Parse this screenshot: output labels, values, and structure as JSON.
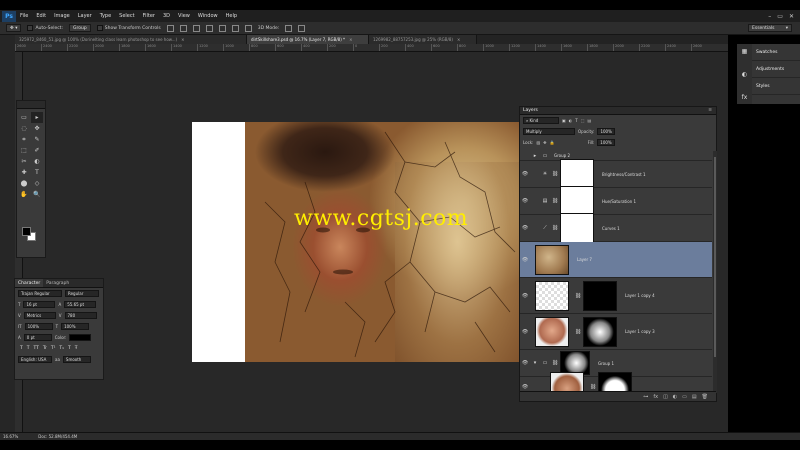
{
  "app": {
    "logo": "Ps"
  },
  "menu": [
    "File",
    "Edit",
    "Image",
    "Layer",
    "Type",
    "Select",
    "Filter",
    "3D",
    "View",
    "Window",
    "Help"
  ],
  "window_controls": [
    "–",
    "▭",
    "✕"
  ],
  "options": {
    "auto_select": "Auto-Select:",
    "group": "Group",
    "show_transform": "Show Transform Controls",
    "mode_3d": "3D Mode:",
    "workspace": "Essentials"
  },
  "tabs": [
    {
      "label": "325972_8460_51.jpg @ 100% (Dorinelting class learn photoshop to see how...)"
    },
    {
      "label": "dirtSkillshare3.psd @ 16.7% (Layer 7, RGB/8) *"
    },
    {
      "label": "1269982_88757253.jpg @ 25% (RGB/8)"
    }
  ],
  "ruler_ticks": [
    "2600",
    "2400",
    "2200",
    "2000",
    "1800",
    "1600",
    "1400",
    "1200",
    "1000",
    "800",
    "600",
    "400",
    "200",
    "0",
    "200",
    "400",
    "600",
    "800",
    "1000",
    "1200",
    "1400",
    "1600",
    "1800",
    "2000",
    "2200",
    "2400",
    "2600"
  ],
  "watermark": "www.cgtsj.com",
  "tools": [
    "▭",
    "▸",
    "◌",
    "✥",
    "⌗",
    "✎",
    "⬚",
    "✐",
    "✂",
    "◐",
    "✚",
    "T",
    "⬤",
    "◇",
    "✋",
    "🔍"
  ],
  "character": {
    "tabs": [
      "Character",
      "Paragraph"
    ],
    "font": "Trajan Regular",
    "style": "Regular",
    "size": "16 pt",
    "leading": "55.65 pt",
    "kerning": "Metrics",
    "tracking": "780",
    "scale_v": "100%",
    "scale_h": "100%",
    "baseline": "0 pt",
    "color_label": "Color:",
    "styles": [
      "T",
      "T",
      "TT",
      "Tr",
      "T¹",
      "T₁",
      "T",
      "Ŧ"
    ],
    "language": "English: USA",
    "aa_label": "aa",
    "antialias": "Smooth"
  },
  "layers_panel": {
    "title": "Layers",
    "kind": "Kind",
    "blend": "Multiply",
    "opacity_label": "Opacity:",
    "opacity": "100%",
    "lock_label": "Lock:",
    "fill_label": "Fill:",
    "fill": "100%",
    "layers": [
      {
        "name": "Group 2",
        "type": "group"
      },
      {
        "name": "Brightness/Contrast 1",
        "type": "adjust",
        "icon": "☀"
      },
      {
        "name": "Hue/Saturation 1",
        "type": "adjust",
        "icon": "▤"
      },
      {
        "name": "Curves 1",
        "type": "adjust",
        "icon": "⟋"
      },
      {
        "name": "Layer 7",
        "type": "pixel",
        "active": true
      },
      {
        "name": "Layer 1 copy 4",
        "type": "masked"
      },
      {
        "name": "Layer 1 copy 3",
        "type": "masked"
      },
      {
        "name": "Group 1",
        "type": "group-open"
      },
      {
        "name": "",
        "type": "masked"
      }
    ],
    "footer_icons": [
      "⊶",
      "fx",
      "◫",
      "◐",
      "▭",
      "▤",
      "🗑"
    ]
  },
  "dock": {
    "items": [
      {
        "icon": "▦",
        "label": "Swatches"
      },
      {
        "icon": "◐",
        "label": "Adjustments"
      },
      {
        "icon": "fx",
        "label": "Styles"
      }
    ]
  },
  "status": {
    "zoom": "16.67%",
    "doc": "Doc: 52.8M/454.4M"
  }
}
